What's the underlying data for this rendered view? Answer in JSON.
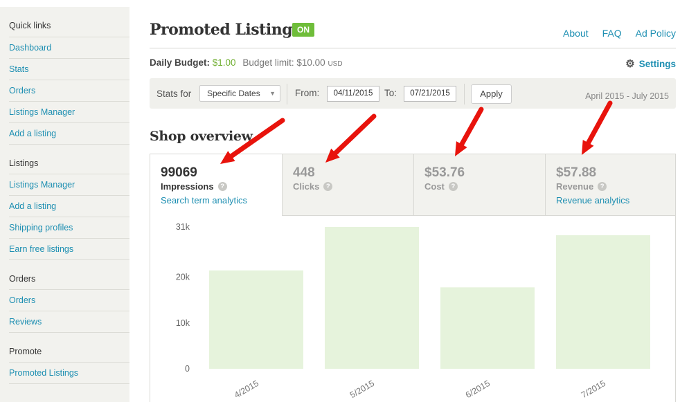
{
  "sidebar": {
    "groups": [
      {
        "title": "Quick links",
        "items": [
          "Dashboard",
          "Stats",
          "Orders",
          "Listings Manager",
          "Add a listing"
        ]
      },
      {
        "title": "Listings",
        "items": [
          "Listings Manager",
          "Add a listing",
          "Shipping profiles",
          "Earn free listings"
        ]
      },
      {
        "title": "Orders",
        "items": [
          "Orders",
          "Reviews"
        ]
      },
      {
        "title": "Promote",
        "items": [
          "Promoted Listings"
        ]
      }
    ]
  },
  "header": {
    "title": "Promoted Listings",
    "status_badge": "ON",
    "links": [
      "About",
      "FAQ",
      "Ad Policy"
    ]
  },
  "budget": {
    "daily_label": "Daily Budget:",
    "daily_value": "$1.00",
    "limit_label": "Budget limit: $10.00",
    "currency": "USD",
    "settings_label": "Settings"
  },
  "filter": {
    "stats_for_label": "Stats for",
    "selected_range": "Specific Dates",
    "from_label": "From:",
    "from_value": "04/11/2015",
    "to_label": "To:",
    "to_value": "07/21/2015",
    "apply_label": "Apply",
    "range_label": "April 2015 - July 2015"
  },
  "overview": {
    "title": "Shop overview",
    "tabs": [
      {
        "value": "99069",
        "label": "Impressions",
        "link": "Search term analytics",
        "active": true
      },
      {
        "value": "448",
        "label": "Clicks",
        "link": "",
        "active": false
      },
      {
        "value": "$53.76",
        "label": "Cost",
        "link": "",
        "active": false
      },
      {
        "value": "$57.88",
        "label": "Revenue",
        "link": "Revenue analytics",
        "active": false
      }
    ]
  },
  "chart_data": {
    "type": "bar",
    "categories": [
      "4/2015",
      "5/2015",
      "6/2015",
      "7/2015"
    ],
    "values": [
      21500,
      31000,
      17800,
      29200
    ],
    "yticks": [
      0,
      10000,
      20000,
      31000
    ],
    "ytick_labels": [
      "0",
      "10k",
      "20k",
      "31k"
    ],
    "ylim": [
      0,
      31000
    ],
    "bar_color": "#e6f3dc"
  },
  "colors": {
    "accent_link": "#1e8fb2",
    "on_badge": "#6fbd3a",
    "budget_value": "#6fae2f",
    "annotation_arrow": "#e8130c"
  },
  "icons": {
    "settings": "gear-icon",
    "help": "question-icon",
    "dropdown": "chevron-down-icon"
  }
}
